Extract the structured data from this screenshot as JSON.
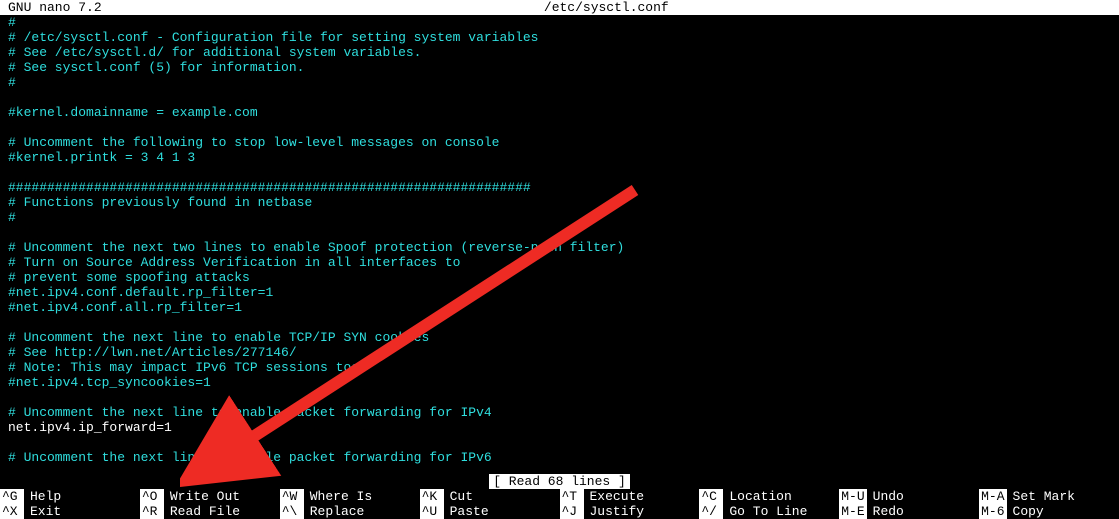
{
  "titlebar": {
    "app": "  GNU nano 7.2",
    "file": "/etc/sysctl.conf"
  },
  "lines": [
    {
      "t": "comment",
      "v": "#"
    },
    {
      "t": "comment",
      "v": "# /etc/sysctl.conf - Configuration file for setting system variables"
    },
    {
      "t": "comment",
      "v": "# See /etc/sysctl.d/ for additional system variables."
    },
    {
      "t": "comment",
      "v": "# See sysctl.conf (5) for information."
    },
    {
      "t": "comment",
      "v": "#"
    },
    {
      "t": "blank",
      "v": ""
    },
    {
      "t": "comment",
      "v": "#kernel.domainname = example.com"
    },
    {
      "t": "blank",
      "v": ""
    },
    {
      "t": "comment",
      "v": "# Uncomment the following to stop low-level messages on console"
    },
    {
      "t": "comment",
      "v": "#kernel.printk = 3 4 1 3"
    },
    {
      "t": "blank",
      "v": ""
    },
    {
      "t": "comment",
      "v": "###################################################################"
    },
    {
      "t": "comment",
      "v": "# Functions previously found in netbase"
    },
    {
      "t": "comment",
      "v": "#"
    },
    {
      "t": "blank",
      "v": ""
    },
    {
      "t": "comment",
      "v": "# Uncomment the next two lines to enable Spoof protection (reverse-path filter)"
    },
    {
      "t": "comment",
      "v": "# Turn on Source Address Verification in all interfaces to"
    },
    {
      "t": "comment",
      "v": "# prevent some spoofing attacks"
    },
    {
      "t": "comment",
      "v": "#net.ipv4.conf.default.rp_filter=1"
    },
    {
      "t": "comment",
      "v": "#net.ipv4.conf.all.rp_filter=1"
    },
    {
      "t": "blank",
      "v": ""
    },
    {
      "t": "comment",
      "v": "# Uncomment the next line to enable TCP/IP SYN cookies"
    },
    {
      "t": "comment",
      "v": "# See http://lwn.net/Articles/277146/"
    },
    {
      "t": "comment",
      "v": "# Note: This may impact IPv6 TCP sessions too"
    },
    {
      "t": "comment",
      "v": "#net.ipv4.tcp_syncookies=1"
    },
    {
      "t": "blank",
      "v": ""
    },
    {
      "t": "comment",
      "v": "# Uncomment the next line to enable packet forwarding for IPv4"
    },
    {
      "t": "plain",
      "v": "net.ipv4.ip_forward=1"
    },
    {
      "t": "blank",
      "v": ""
    },
    {
      "t": "comment",
      "v": "# Uncomment the next line to enable packet forwarding for IPv6"
    }
  ],
  "status": "[ Read 68 lines ]",
  "shortcuts": [
    {
      "key": "^G",
      "label": "Help"
    },
    {
      "key": "^X",
      "label": "Exit"
    },
    {
      "key": "^O",
      "label": "Write Out"
    },
    {
      "key": "^R",
      "label": "Read File"
    },
    {
      "key": "^W",
      "label": "Where Is"
    },
    {
      "key": "^\\",
      "label": "Replace"
    },
    {
      "key": "^K",
      "label": "Cut"
    },
    {
      "key": "^U",
      "label": "Paste"
    },
    {
      "key": "^T",
      "label": "Execute"
    },
    {
      "key": "^J",
      "label": "Justify"
    },
    {
      "key": "^C",
      "label": "Location"
    },
    {
      "key": "^/",
      "label": "Go To Line"
    },
    {
      "key": "M-U",
      "label": "Undo"
    },
    {
      "key": "M-E",
      "label": "Redo"
    },
    {
      "key": "M-A",
      "label": "Set Mark"
    },
    {
      "key": "M-6",
      "label": "Copy"
    }
  ]
}
